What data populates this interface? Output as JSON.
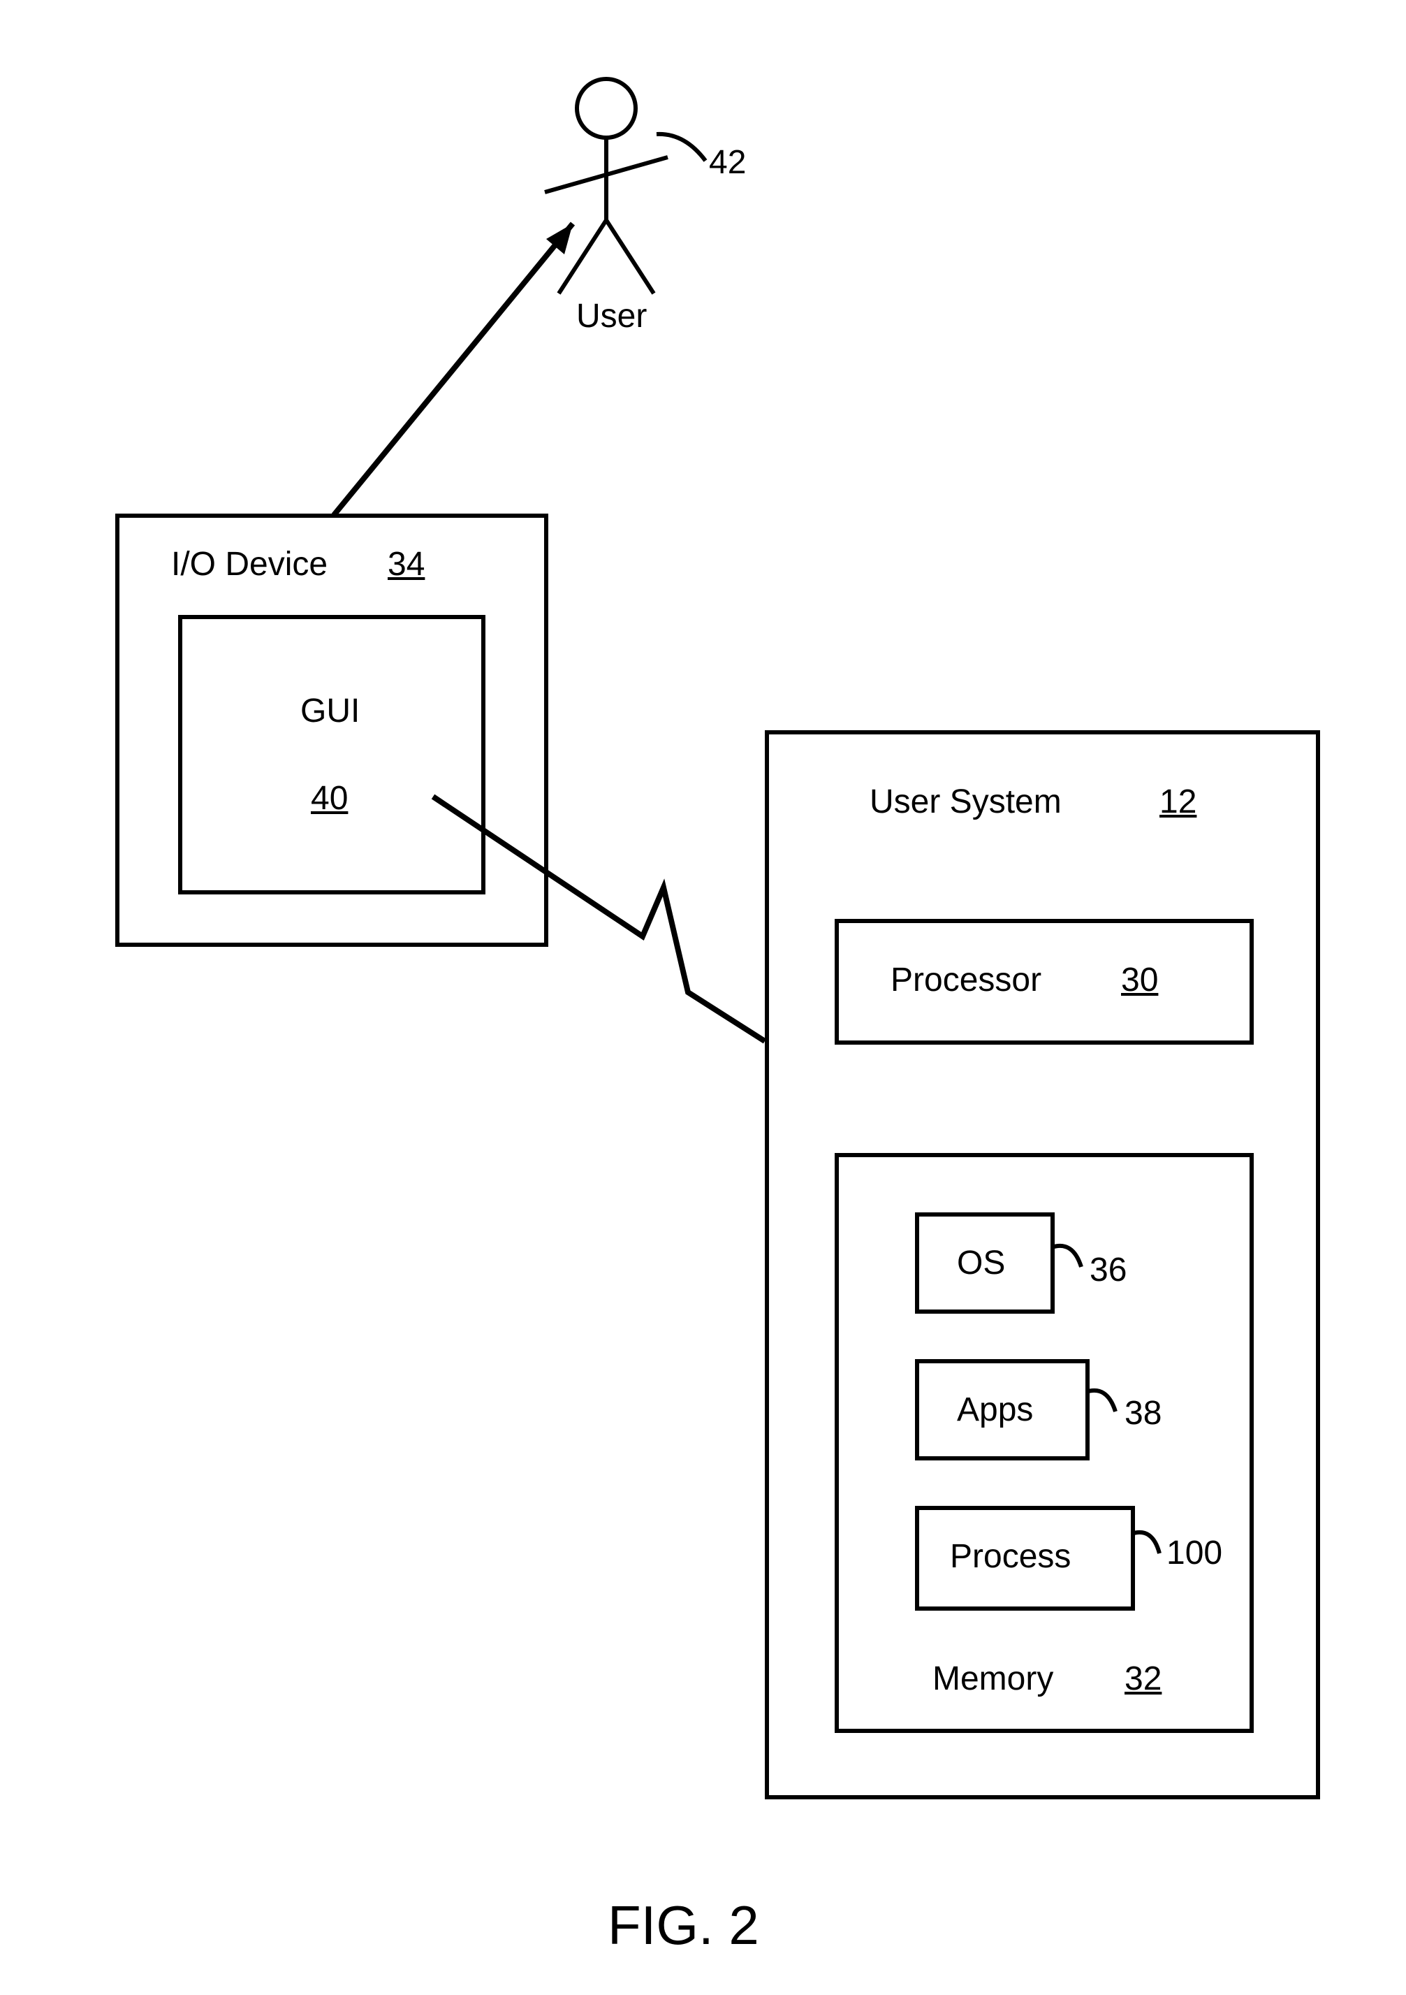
{
  "figure_label": "FIG. 2",
  "user": {
    "label": "User",
    "ref": "42"
  },
  "io_device": {
    "label": "I/O Device",
    "ref": "34",
    "gui": {
      "label": "GUI",
      "ref": "40"
    }
  },
  "user_system": {
    "label": "User System",
    "ref": "12",
    "processor": {
      "label": "Processor",
      "ref": "30"
    },
    "memory": {
      "label": "Memory",
      "ref": "32",
      "os": {
        "label": "OS",
        "ref": "36"
      },
      "apps": {
        "label": "Apps",
        "ref": "38"
      },
      "process": {
        "label": "Process",
        "ref": "100"
      }
    }
  }
}
